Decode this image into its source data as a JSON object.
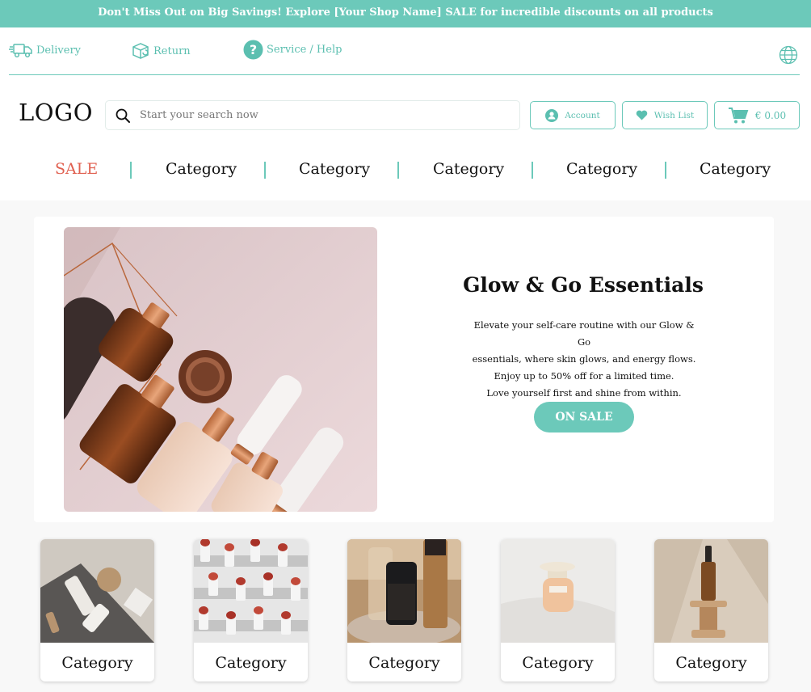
{
  "promo_banner": "Don't Miss Out on Big Savings! Explore [Your Shop Name] SALE for incredible discounts on all products",
  "utility": {
    "delivery": "Delivery",
    "return": "Return",
    "help": "Service / Help"
  },
  "header": {
    "logo": "LOGO",
    "search_placeholder": "Start your search now",
    "account": "Account",
    "wishlist": "Wish List",
    "cart": "€ 0.00"
  },
  "nav": {
    "items": [
      "SALE",
      "Category",
      "Category",
      "Category",
      "Category",
      "Category"
    ]
  },
  "hero": {
    "title": "Glow & Go Essentials",
    "lines": [
      "Elevate your self-care routine with our Glow & Go",
      "essentials, where skin glows, and energy flows.",
      "Enjoy up to 50% off for a limited time.",
      "Love yourself first and shine from within."
    ],
    "button": "ON SALE"
  },
  "categories": {
    "items": [
      "Category",
      "Category",
      "Category",
      "Category",
      "Category"
    ]
  },
  "colors": {
    "accent": "#6cc9ba",
    "sale": "#e06050"
  }
}
